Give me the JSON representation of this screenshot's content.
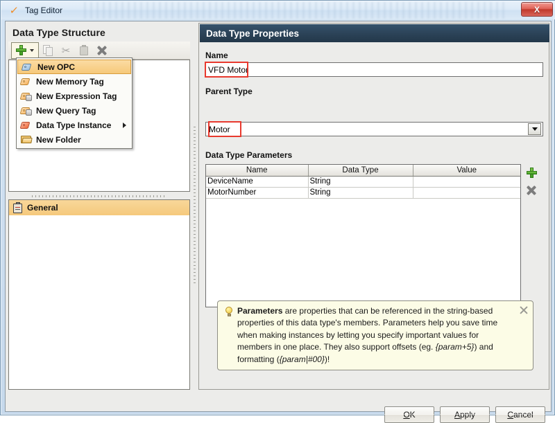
{
  "window": {
    "title": "Tag Editor",
    "app_icon": "checkmark-icon",
    "close_label": "X"
  },
  "left_pane": {
    "title": "Data Type Structure",
    "toolbar": [
      {
        "name": "new-button",
        "icon": "green-plus-icon",
        "enabled": true
      },
      {
        "name": "copy-button",
        "icon": "copy-icon",
        "enabled": false
      },
      {
        "name": "cut-button",
        "icon": "scissors-icon",
        "enabled": false
      },
      {
        "name": "paste-button",
        "icon": "clipboard-icon",
        "enabled": false
      },
      {
        "name": "delete-button",
        "icon": "x-icon",
        "enabled": false
      }
    ],
    "list": {
      "selected_item": "General",
      "items": [
        {
          "label": "General",
          "icon": "clipboard-icon",
          "selected": true
        }
      ]
    }
  },
  "popup_menu": {
    "visible": true,
    "items": [
      {
        "label": "New OPC",
        "icon": "tag-blue-icon",
        "highlighted": true,
        "has_submenu": false
      },
      {
        "label": "New Memory Tag",
        "icon": "tag-orange-icon",
        "highlighted": false,
        "has_submenu": false
      },
      {
        "label": "New Expression Tag",
        "icon": "tag-expression-icon",
        "highlighted": false,
        "has_submenu": false
      },
      {
        "label": "New Query Tag",
        "icon": "tag-query-icon",
        "highlighted": false,
        "has_submenu": false
      },
      {
        "label": "Data Type Instance",
        "icon": "tag-red-icon",
        "highlighted": false,
        "has_submenu": true
      },
      {
        "label": "New Folder",
        "icon": "folder-icon",
        "highlighted": false,
        "has_submenu": false
      }
    ]
  },
  "right_pane": {
    "header": "Data Type Properties",
    "name_field": {
      "label": "Name",
      "value": "VFD Motor",
      "highlight_color": "#e8392e"
    },
    "parent_type_field": {
      "label": "Parent Type",
      "value": "Motor",
      "highlight_color": "#e8392e"
    },
    "parameters": {
      "label": "Data Type Parameters",
      "columns": [
        "Name",
        "Data Type",
        "Value"
      ],
      "rows": [
        {
          "name": "DeviceName",
          "data_type": "String",
          "value": ""
        },
        {
          "name": "MotorNumber",
          "data_type": "String",
          "value": ""
        }
      ],
      "add_button": "add-parameter-button",
      "remove_button": "remove-parameter-button"
    },
    "info_box": {
      "icon": "lightbulb-icon",
      "bold_lead": "Parameters",
      "text_1": " are properties that can be referenced in the string-based properties of this data type's members. Parameters help you save time when making instances by letting you specify important values for members in one place. They also support offsets (eg. ",
      "italic_1": "{param+5}",
      "text_2": ") and formatting (",
      "italic_2": "{param|#00}",
      "text_3": ")!",
      "close_icon": "close-icon"
    }
  },
  "footer": {
    "buttons": [
      {
        "label": "OK",
        "mnemonic": "O"
      },
      {
        "label": "Apply",
        "mnemonic": "A"
      },
      {
        "label": "Cancel",
        "mnemonic": "C"
      }
    ]
  }
}
